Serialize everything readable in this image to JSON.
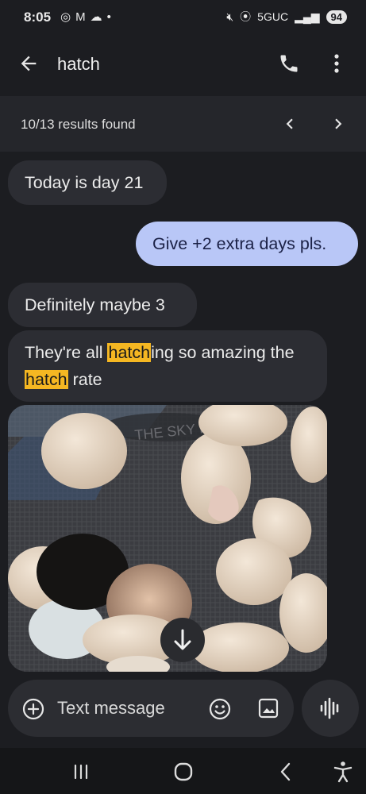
{
  "status_bar": {
    "time": "8:05",
    "network": "5GUC",
    "battery": "94"
  },
  "app_bar": {
    "title": "hatch"
  },
  "search": {
    "results_text": "10/13 results found"
  },
  "messages": [
    {
      "direction": "incoming",
      "parts": [
        {
          "text": "Today is day 21"
        }
      ]
    },
    {
      "direction": "outgoing",
      "parts": [
        {
          "text": "Give +2 extra days pls."
        }
      ]
    },
    {
      "direction": "incoming",
      "parts": [
        {
          "text": "Definitely maybe 3"
        }
      ]
    },
    {
      "direction": "incoming",
      "parts": [
        {
          "text": "They're all "
        },
        {
          "text": "hatch",
          "highlight": true
        },
        {
          "text": "ing so amazing the "
        },
        {
          "text": "hatch",
          "highlight": true
        },
        {
          "text": " rate"
        }
      ]
    }
  ],
  "photo_text": "THE SKY RIS",
  "composer": {
    "placeholder": "Text message"
  },
  "icons": {
    "back": "arrow-left-icon",
    "phone": "phone-icon",
    "more": "more-vert-icon",
    "prev": "chevron-left-icon",
    "next": "chevron-right-icon",
    "add": "add-circle-icon",
    "emoji": "emoji-icon",
    "gallery": "gallery-icon",
    "voice": "voice-waveform-icon",
    "scroll": "arrow-down-icon"
  },
  "colors": {
    "background": "#1c1d21",
    "incoming_bubble": "#2c2d33",
    "outgoing_bubble": "#b9c7f7",
    "highlight": "#f5b722"
  }
}
